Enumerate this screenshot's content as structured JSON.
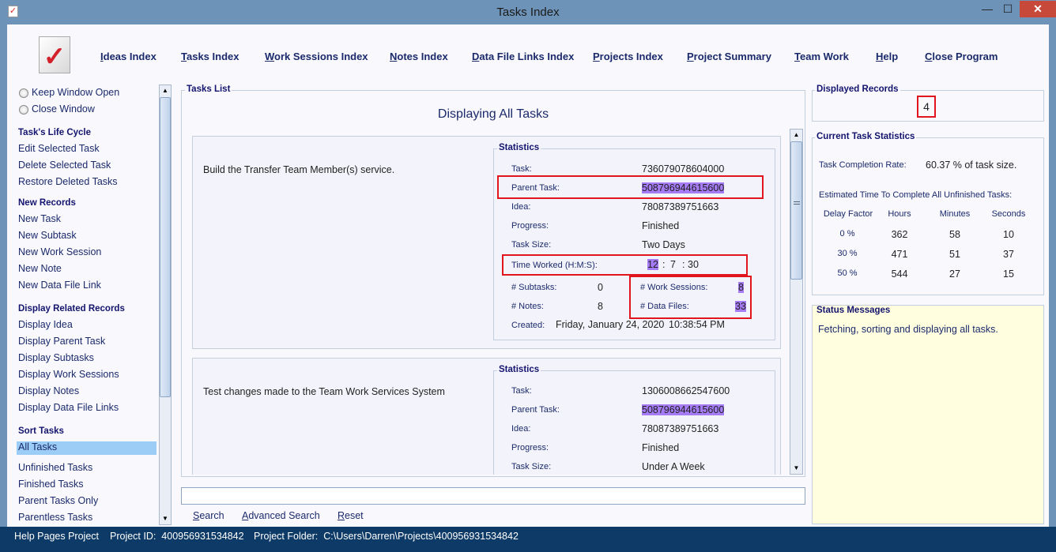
{
  "window": {
    "title": "Tasks Index",
    "minimize": "—",
    "maximize": "☐",
    "close": "✕"
  },
  "nav": [
    "Ideas Index",
    "Tasks Index",
    "Work Sessions Index",
    "Notes Index",
    "Data File Links Index",
    "Projects Index",
    "Project Summary",
    "Team Work",
    "Help",
    "Close Program"
  ],
  "sidebar": {
    "radios": [
      "Keep Window Open",
      "Close Window"
    ],
    "sections": [
      {
        "heading": "Task's Life Cycle",
        "items": [
          "Edit Selected Task",
          "Delete Selected Task",
          "Restore Deleted Tasks"
        ]
      },
      {
        "heading": "New Records",
        "items": [
          "New Task",
          "New Subtask",
          "New Work Session",
          "New Note",
          "New Data File Link"
        ]
      },
      {
        "heading": "Display Related Records",
        "items": [
          "Display Idea",
          "Display Parent Task",
          "Display Subtasks",
          "Display Work Sessions",
          "Display Notes",
          "Display Data File Links"
        ]
      },
      {
        "heading": "Sort Tasks",
        "items": [
          "All Tasks",
          "Unfinished Tasks",
          "Finished Tasks",
          "Parent Tasks Only",
          "Parentless Tasks"
        ],
        "selected": "All Tasks"
      }
    ]
  },
  "tasks_list": {
    "label": "Tasks List",
    "heading": "Displaying All Tasks",
    "tasks": [
      {
        "description": "Build the Transfer Team Member(s) service.",
        "stats_label": "Statistics",
        "task": "736079078604000",
        "parent_task": "508796944615600",
        "idea": "78087389751663",
        "progress": "Finished",
        "task_size": "Two Days",
        "time_h": "12",
        "time_m": "7",
        "time_s": "30",
        "subtasks": "0",
        "notes": "8",
        "work_sessions": "8",
        "data_files": "33",
        "created_date": "Friday, January 24, 2020",
        "created_time": "10:38:54 PM"
      },
      {
        "description": "Test changes made to the Team Work Services System",
        "stats_label": "Statistics",
        "task": "1306008662547600",
        "parent_task": "508796944615600",
        "idea": "78087389751663",
        "progress": "Finished",
        "task_size": "Under A Week"
      }
    ],
    "labels": {
      "task": "Task:",
      "parent_task": "Parent Task:",
      "idea": "Idea:",
      "progress": "Progress:",
      "task_size": "Task Size:",
      "time_worked": "Time Worked (H:M:S):",
      "subtasks": "# Subtasks:",
      "notes": "# Notes:",
      "work_sessions": "# Work Sessions:",
      "data_files": "# Data Files:",
      "created": "Created:",
      "colon": ":"
    }
  },
  "search": {
    "value": "",
    "search": "Search",
    "advanced": "Advanced Search",
    "reset": "Reset"
  },
  "displayed_records": {
    "label": "Displayed Records",
    "value": "4"
  },
  "current_stats": {
    "label": "Current Task Statistics",
    "completion_label": "Task Completion Rate:",
    "completion_value": "60.37 % of task size.",
    "estimate_label": "Estimated Time To Complete All Unfinished Tasks:",
    "columns": [
      "Delay Factor",
      "Hours",
      "Minutes",
      "Seconds"
    ],
    "rows": [
      [
        "0 %",
        "362",
        "58",
        "10"
      ],
      [
        "30 %",
        "471",
        "51",
        "37"
      ],
      [
        "50 %",
        "544",
        "27",
        "15"
      ]
    ]
  },
  "status": {
    "label": "Status Messages",
    "message": "Fetching, sorting and displaying all tasks."
  },
  "footer": {
    "project": "Help Pages Project",
    "project_id": "Project ID:  400956931534842",
    "folder": "Project Folder:  C:\\Users\\Darren\\Projects\\400956931534842"
  },
  "colors": {
    "titlebar": "#6d93b8",
    "highlight": "#a57cf5",
    "selection": "#9ccdf6",
    "annotation": "#e0151d",
    "footer": "#0d3a66"
  }
}
